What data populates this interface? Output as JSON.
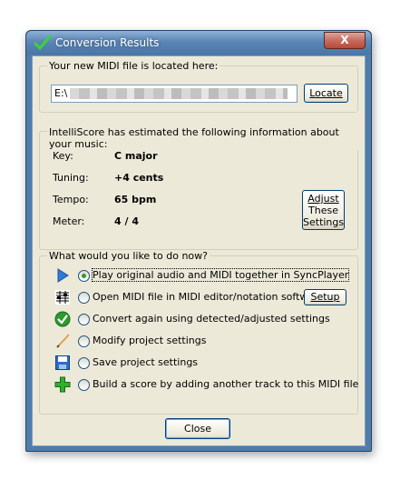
{
  "window": {
    "title": "Conversion Results",
    "close_symbol": "X",
    "title_icon": "green-check-icon"
  },
  "location": {
    "group_label": "Your new MIDI file is located here:",
    "path_visible": "E:\\",
    "locate_label": "Locate"
  },
  "info": {
    "group_label": "IntelliScore has estimated the following information about your music:",
    "rows": [
      {
        "label": "Key:",
        "value": "C major"
      },
      {
        "label": "Tuning:",
        "value": "+4 cents"
      },
      {
        "label": "Tempo:",
        "value": "65 bpm"
      },
      {
        "label": "Meter:",
        "value": "4 / 4"
      }
    ],
    "adjust_line1": "Adjust",
    "adjust_line2": "These",
    "adjust_line3": "Settings"
  },
  "actions": {
    "group_label": "What would you like to do now?",
    "options": [
      {
        "label": "Play original audio and MIDI together in SyncPlayer",
        "icon": "play-icon",
        "selected": true
      },
      {
        "label": "Open MIDI file in MIDI editor/notation software",
        "icon": "notation-icon",
        "selected": false
      },
      {
        "label": "Convert again using detected/adjusted settings",
        "icon": "green-check-icon",
        "selected": false
      },
      {
        "label": "Modify project settings",
        "icon": "pencil-icon",
        "selected": false
      },
      {
        "label": "Save project settings",
        "icon": "floppy-disk-icon",
        "selected": false
      },
      {
        "label": "Build a score by adding another track to this MIDI file",
        "icon": "green-plus-icon",
        "selected": false
      }
    ],
    "setup_label": "Setup"
  },
  "footer": {
    "close_label": "Close"
  },
  "colors": {
    "titlebar": "#5b86b6",
    "dialog_bg": "#ece9d8",
    "radio_dot": "#2f9a2f"
  }
}
